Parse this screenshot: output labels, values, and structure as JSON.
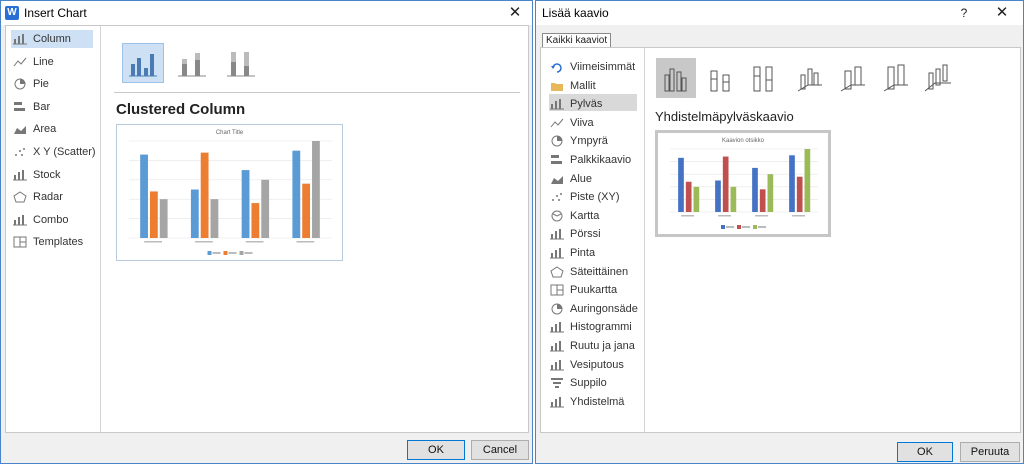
{
  "left": {
    "title": "Insert Chart",
    "close_symbol": "✕",
    "sidebar": [
      {
        "label": "Column",
        "icon": "column-chart-icon"
      },
      {
        "label": "Line",
        "icon": "line-chart-icon"
      },
      {
        "label": "Pie",
        "icon": "pie-chart-icon"
      },
      {
        "label": "Bar",
        "icon": "bar-chart-icon"
      },
      {
        "label": "Area",
        "icon": "area-chart-icon"
      },
      {
        "label": "X Y (Scatter)",
        "icon": "scatter-chart-icon"
      },
      {
        "label": "Stock",
        "icon": "stock-chart-icon"
      },
      {
        "label": "Radar",
        "icon": "radar-chart-icon"
      },
      {
        "label": "Combo",
        "icon": "combo-chart-icon"
      },
      {
        "label": "Templates",
        "icon": "templates-icon"
      }
    ],
    "heading": "Clustered Column",
    "preview_title": "Chart Title",
    "ok": "OK",
    "cancel": "Cancel",
    "accent": "#0078d7",
    "series_colors": [
      "#5b9bd5",
      "#ed7d31",
      "#a5a5a5"
    ]
  },
  "right": {
    "title": "Lisää kaavio",
    "help_symbol": "?",
    "close_symbol": "✕",
    "tab": "Kaikki kaaviot",
    "sidebar": [
      {
        "label": "Viimeisimmät",
        "icon": "recent-icon"
      },
      {
        "label": "Mallit",
        "icon": "folder-icon"
      },
      {
        "label": "Pylväs",
        "icon": "column-chart-icon"
      },
      {
        "label": "Viiva",
        "icon": "line-chart-icon"
      },
      {
        "label": "Ympyrä",
        "icon": "pie-chart-icon"
      },
      {
        "label": "Palkkikaavio",
        "icon": "bar-chart-icon"
      },
      {
        "label": "Alue",
        "icon": "area-chart-icon"
      },
      {
        "label": "Piste (XY)",
        "icon": "scatter-chart-icon"
      },
      {
        "label": "Kartta",
        "icon": "map-chart-icon"
      },
      {
        "label": "Pörssi",
        "icon": "stock-chart-icon"
      },
      {
        "label": "Pinta",
        "icon": "surface-chart-icon"
      },
      {
        "label": "Säteittäinen",
        "icon": "radar-chart-icon"
      },
      {
        "label": "Puukartta",
        "icon": "treemap-icon"
      },
      {
        "label": "Auringonsäde",
        "icon": "sunburst-icon"
      },
      {
        "label": "Histogrammi",
        "icon": "histogram-icon"
      },
      {
        "label": "Ruutu ja jana",
        "icon": "box-whisker-icon"
      },
      {
        "label": "Vesiputous",
        "icon": "waterfall-icon"
      },
      {
        "label": "Suppilo",
        "icon": "funnel-icon"
      },
      {
        "label": "Yhdistelmä",
        "icon": "combo-chart-icon"
      }
    ],
    "heading": "Yhdistelmäpylväskaavio",
    "preview_title": "Kaavion otsikko",
    "ok": "OK",
    "cancel": "Peruuta",
    "series_colors": [
      "#4472c4",
      "#c0504d",
      "#9bbb59"
    ]
  }
}
